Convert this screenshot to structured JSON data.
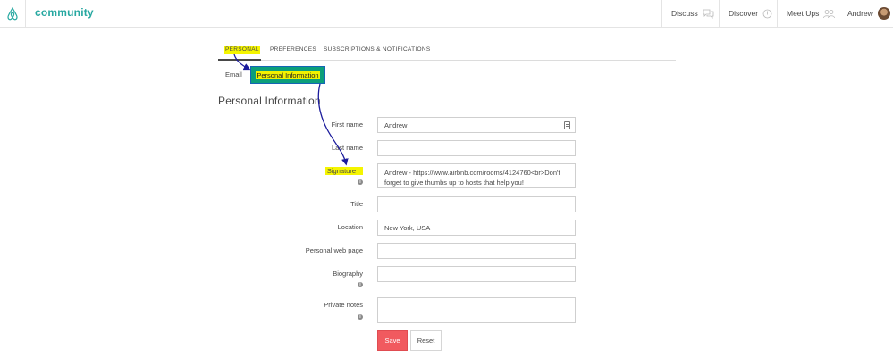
{
  "header": {
    "brand": "community",
    "nav": {
      "discuss": "Discuss",
      "discover": "Discover",
      "meetups": "Meet Ups",
      "user": "Andrew"
    }
  },
  "tabs": {
    "personal": "PERSONAL",
    "preferences": "PREFERENCES",
    "subscriptions": "SUBSCRIPTIONS & NOTIFICATIONS"
  },
  "subtabs": {
    "email": "Email",
    "personal_information": "Personal Information"
  },
  "section_title": "Personal Information",
  "form": {
    "first_name": {
      "label": "First name",
      "value": "Andrew"
    },
    "last_name": {
      "label": "Last name",
      "value": ""
    },
    "signature": {
      "label": "Signature",
      "value": "Andrew - https://www.airbnb.com/rooms/4124760<br>Don't forget to give thumbs up to hosts that help you!"
    },
    "title": {
      "label": "Title",
      "value": ""
    },
    "location": {
      "label": "Location",
      "value": "New York, USA"
    },
    "web_page": {
      "label": "Personal web page",
      "value": ""
    },
    "biography": {
      "label": "Biography",
      "value": ""
    },
    "private_notes": {
      "label": "Private notes",
      "value": ""
    }
  },
  "buttons": {
    "save": "Save",
    "reset": "Reset"
  },
  "colors": {
    "brand": "#27a8a1",
    "save": "#f15a5f",
    "highlight": "#f5f500",
    "active_subtab": "#0c9f7a",
    "annotation_arrow": "#1b1b9c"
  }
}
